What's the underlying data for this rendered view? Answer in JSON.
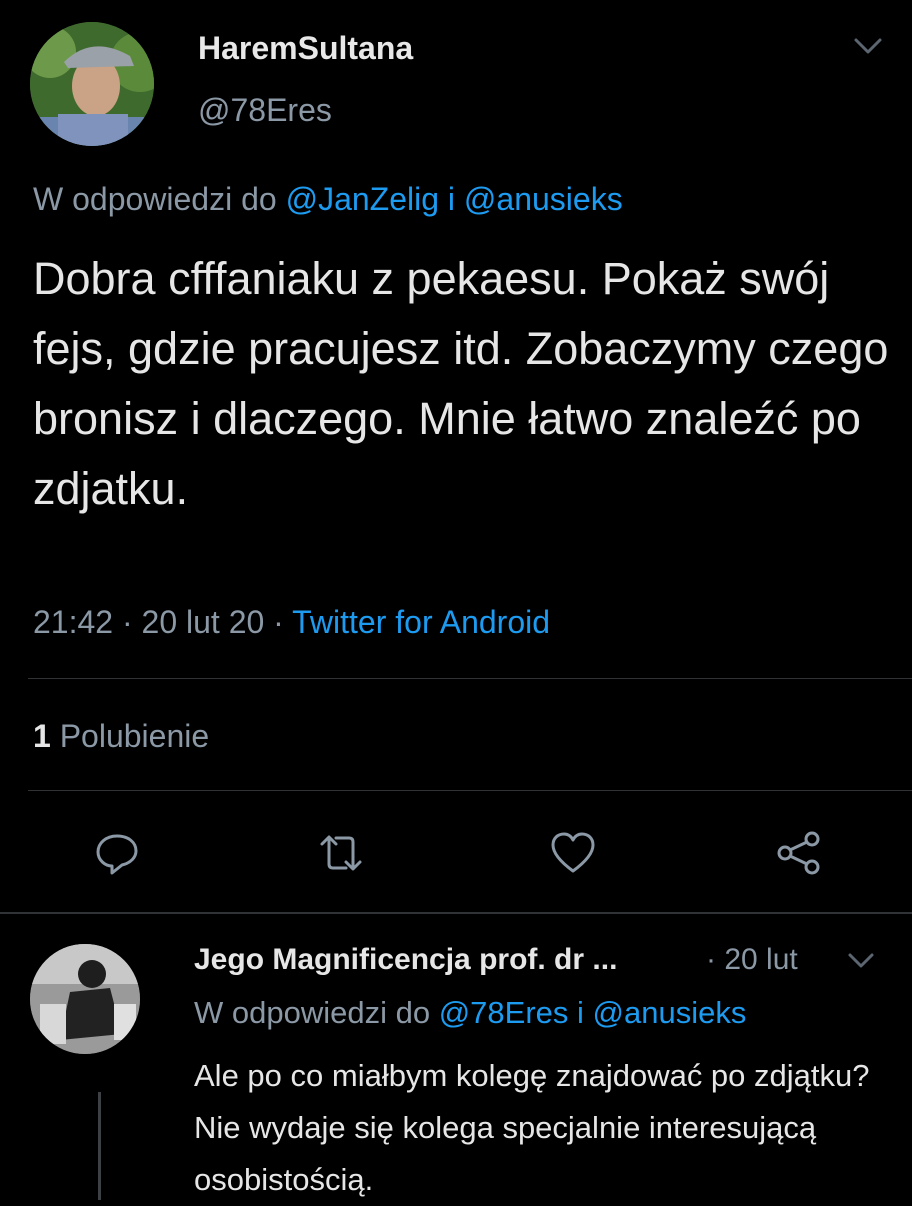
{
  "tweet": {
    "author_name": "HaremSultana",
    "author_handle": "@78Eres",
    "reply_prefix": "W odpowiedzi do",
    "reply_mention_1": "@JanZelig",
    "reply_and": "i",
    "reply_mention_2": "@anusieks",
    "text": "Dobra cfffaniaku z pekaesu. Pokaż swój fejs, gdzie pracujesz itd. Zobaczymy czego bronisz i dlaczego. Mnie łatwo znaleźć po zdjatku.",
    "time": "21:42",
    "dot": "·",
    "date": "20 lut 20",
    "source": "Twitter for Android",
    "likes_count": "1",
    "likes_label": "Polubienie"
  },
  "actions": {
    "reply_icon": "speech-bubble-icon",
    "retweet_icon": "retweet-icon",
    "like_icon": "heart-icon",
    "share_icon": "share-icon"
  },
  "reply": {
    "author_name": "Jego Magnificencja prof. dr ...",
    "date_sep": "·",
    "date": "20 lut",
    "reply_prefix": "W odpowiedzi do",
    "reply_mention_1": "@78Eres",
    "reply_and": "i",
    "reply_mention_2": "@anusieks",
    "text": "Ale po co miałbym kolegę znajdować po zdjątku? Nie wydaje się kolega specjalnie interesującą osobistością."
  },
  "colors": {
    "background": "#000000",
    "text": "#e6e6e6",
    "secondary": "#8b98a5",
    "link": "#1d9bf0",
    "divider": "#2f3336"
  }
}
